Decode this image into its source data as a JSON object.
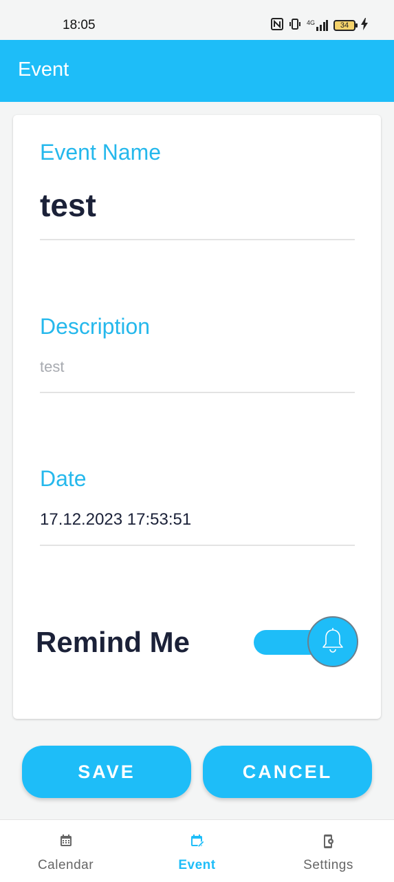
{
  "status_bar": {
    "time": "18:05",
    "battery": "34",
    "network": "4G",
    "icons": [
      "nfc-icon",
      "vibrate-icon",
      "signal-icon",
      "battery-icon",
      "charging-icon"
    ]
  },
  "app_bar": {
    "title": "Event"
  },
  "form": {
    "event_name_label": "Event Name",
    "event_name_value": "test",
    "description_label": "Description",
    "description_value": "test",
    "date_label": "Date",
    "date_value": "17.12.2023 17:53:51",
    "remind_label": "Remind Me",
    "remind_on": true
  },
  "actions": {
    "save_label": "SAVE",
    "cancel_label": "CANCEL"
  },
  "bottom_nav": {
    "items": [
      {
        "label": "Calendar",
        "icon": "calendar-icon",
        "active": false
      },
      {
        "label": "Event",
        "icon": "event-edit-icon",
        "active": true
      },
      {
        "label": "Settings",
        "icon": "settings-phone-icon",
        "active": false
      }
    ]
  },
  "colors": {
    "accent": "#1ebdf8",
    "label": "#25b8ec",
    "dark_text": "#1b2138",
    "muted_text": "#a7aab0",
    "background": "#f4f5f5"
  }
}
